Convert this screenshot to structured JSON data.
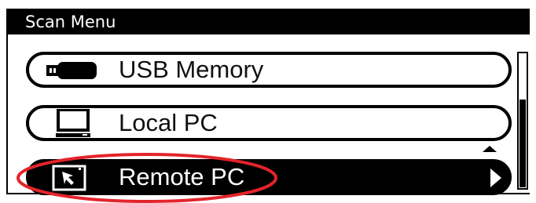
{
  "window": {
    "title": "Scan Menu"
  },
  "menu": {
    "items": [
      {
        "label": "USB Memory",
        "icon": "usb-drive-icon",
        "selected": false
      },
      {
        "label": "Local PC",
        "icon": "computer-monitor-icon",
        "selected": false
      },
      {
        "label": "Remote PC",
        "icon": "remote-pc-icon",
        "selected": true
      }
    ]
  },
  "colors": {
    "highlight": "#000000",
    "annotation": "#e3242b"
  }
}
